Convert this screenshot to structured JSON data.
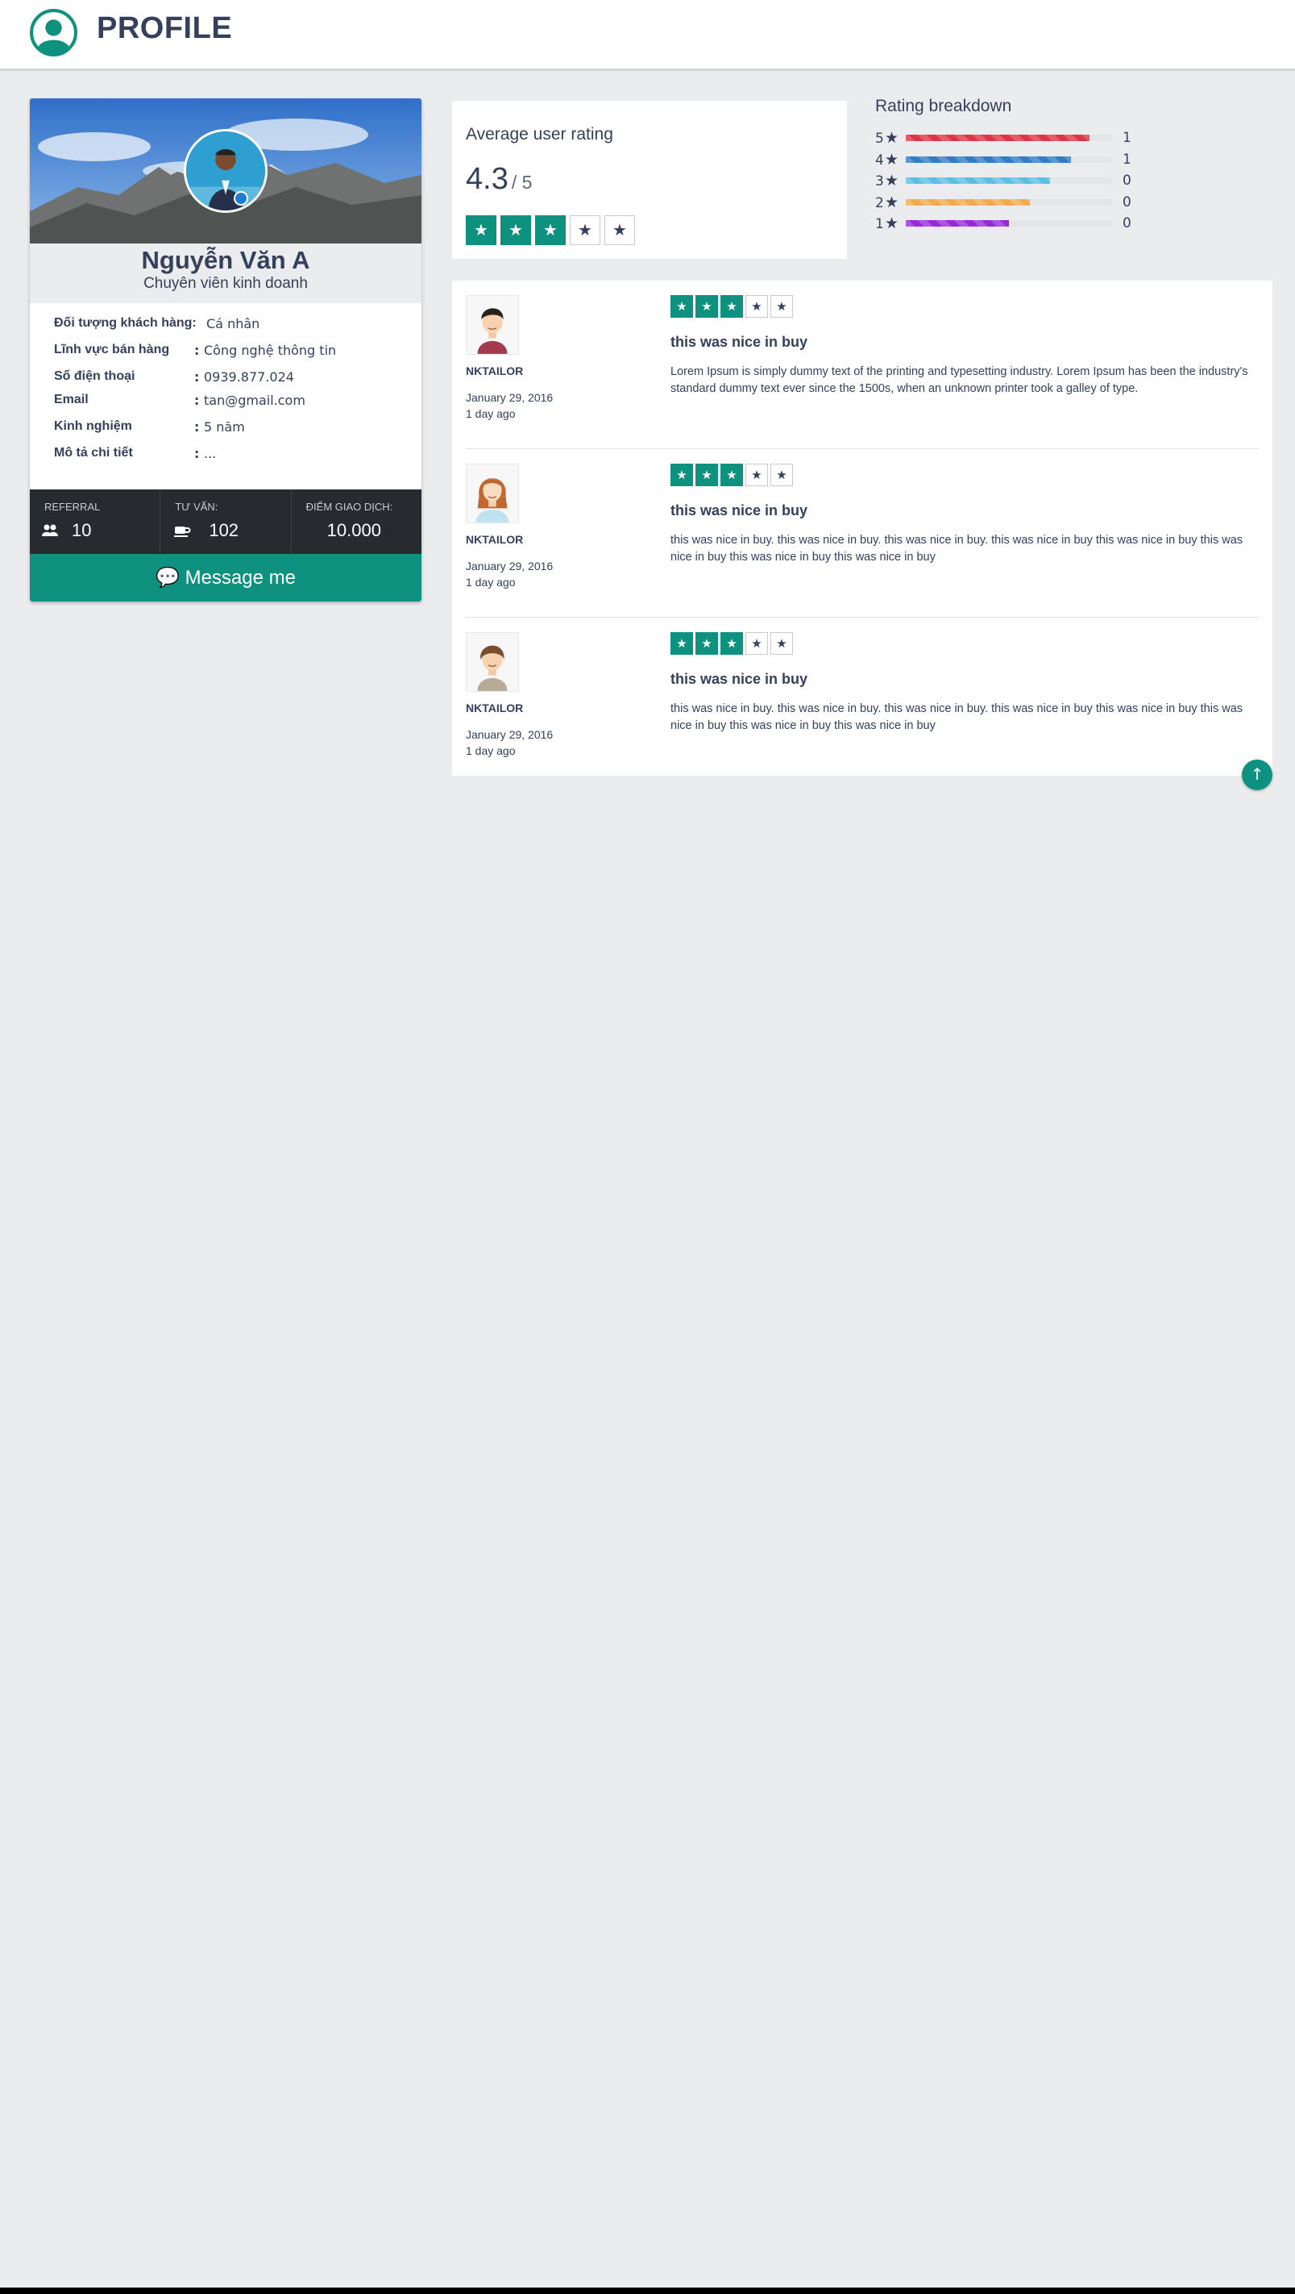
{
  "header": {
    "title": "PROFILE",
    "logo_icon": "user-circle-icon"
  },
  "profile": {
    "name": "Nguyễn Văn A",
    "role": "Chuyên viên kinh doanh",
    "fields": [
      {
        "label": "Đối tượng khách hàng:",
        "colon": "",
        "value": "Cá nhân"
      },
      {
        "label": "Lĩnh vực bán hàng",
        "colon": ":",
        "value": "Công nghệ thông tin"
      },
      {
        "label": "Số điện thoại",
        "colon": ":",
        "value": "0939.877.024"
      },
      {
        "label": "Email",
        "colon": ":",
        "value": "tan@gmail.com"
      },
      {
        "label": "Kinh nghiệm",
        "colon": ":",
        "value": "5 năm"
      },
      {
        "label": "Mô tả chi tiết",
        "colon": ":",
        "value": "..."
      }
    ],
    "stats": [
      {
        "label": "REFERRAL",
        "value": "10",
        "icon": "users-icon"
      },
      {
        "label": "TƯ VẤN:",
        "value": "102",
        "icon": "coffee-icon"
      },
      {
        "label": "ĐIỂM GIAO DỊCH:",
        "value": "10.000",
        "icon": ""
      }
    ],
    "message_button": "Message me"
  },
  "average": {
    "label": "Average user rating",
    "score": "4.3",
    "out_of": "/ 5",
    "stars_filled": 3,
    "stars_total": 5
  },
  "breakdown": {
    "title": "Rating breakdown",
    "rows": [
      {
        "stars": "5",
        "count": "1",
        "fill": 0.89,
        "color": "#dc3545"
      },
      {
        "stars": "4",
        "count": "1",
        "fill": 0.8,
        "color": "#2f7cc9"
      },
      {
        "stars": "3",
        "count": "0",
        "fill": 0.7,
        "color": "#5bc0de"
      },
      {
        "stars": "2",
        "count": "0",
        "fill": 0.6,
        "color": "#f0ad4e"
      },
      {
        "stars": "1",
        "count": "0",
        "fill": 0.5,
        "color": "#9b2ad6"
      }
    ]
  },
  "reviews": [
    {
      "author": "NKTAILOR",
      "date": "January 29, 2016",
      "ago": "1 day ago",
      "stars_filled": 3,
      "title": "this was nice in buy",
      "body": "Lorem Ipsum is simply dummy text of the printing and typesetting industry. Lorem Ipsum has been the industry's standard dummy text ever since the 1500s, when an unknown printer took a galley of type.",
      "avatar": "male-avatar-1"
    },
    {
      "author": "NKTAILOR",
      "date": "January 29, 2016",
      "ago": "1 day ago",
      "stars_filled": 3,
      "title": "this was nice in buy",
      "body": "this was nice in buy. this was nice in buy. this was nice in buy. this was nice in buy this was nice in buy this was nice in buy this was nice in buy this was nice in buy",
      "avatar": "female-avatar"
    },
    {
      "author": "NKTAILOR",
      "date": "January 29, 2016",
      "ago": "1 day ago",
      "stars_filled": 3,
      "title": "this was nice in buy",
      "body": "this was nice in buy. this was nice in buy. this was nice in buy. this was nice in buy this was nice in buy this was nice in buy this was nice in buy this was nice in buy",
      "avatar": "male-avatar-2"
    }
  ],
  "colors": {
    "accent": "#0f9180",
    "text": "#34405c",
    "dark": "#272b30"
  }
}
